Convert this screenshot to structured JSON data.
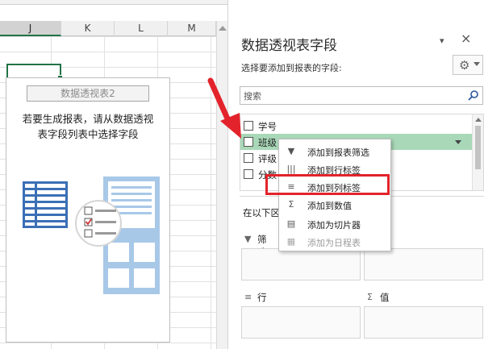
{
  "sheet": {
    "columns": [
      "J",
      "K",
      "L",
      "M"
    ],
    "selected_column": "J"
  },
  "pivot_placeholder": {
    "name": "数据透视表2",
    "message_line1": "若要生成报表，请从数据透视",
    "message_line2": "表字段列表中选择字段"
  },
  "pane": {
    "title": "数据透视表字段",
    "subtitle": "选择要添加到报表的字段:",
    "close_dropdown_glyph": "▾",
    "close_glyph": "×",
    "gear_icon": "gear-icon",
    "search": {
      "placeholder": "搜索"
    },
    "fields": [
      {
        "label": "学号",
        "checked": false,
        "highlighted": false
      },
      {
        "label": "班级",
        "checked": false,
        "highlighted": true
      },
      {
        "label": "评级",
        "checked": false,
        "highlighted": false
      },
      {
        "label": "分数",
        "checked": false,
        "highlighted": false
      }
    ],
    "drag_label": "在以下区",
    "areas": {
      "filter": {
        "label": "筛选",
        "icon": "▼"
      },
      "rows": {
        "label": "行",
        "icon": "≡"
      },
      "values": {
        "label": "值",
        "icon": "Σ"
      }
    }
  },
  "context_menu": {
    "items": [
      {
        "label": "添加到报表筛选",
        "icon": "▼",
        "icon_name": "filter-icon",
        "disabled": false
      },
      {
        "label": "添加到行标签",
        "icon": "|||",
        "icon_name": "row-labels-icon",
        "disabled": false
      },
      {
        "label": "添加到列标签",
        "icon": "≡",
        "icon_name": "column-labels-icon",
        "disabled": false
      },
      {
        "label": "添加到数值",
        "icon": "Σ",
        "icon_name": "sum-icon",
        "disabled": false
      },
      {
        "label": "添加为切片器",
        "icon": "▤",
        "icon_name": "slicer-icon",
        "disabled": false
      },
      {
        "label": "添加为日程表",
        "icon": "▦",
        "icon_name": "timeline-icon",
        "disabled": true
      }
    ],
    "highlighted_item": "添加到列标签"
  },
  "colors": {
    "highlight_green": "#a9d8b8",
    "annotation_red": "#e3232b",
    "excel_green": "#217346"
  }
}
